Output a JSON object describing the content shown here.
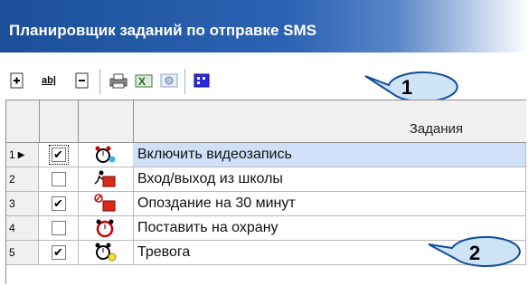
{
  "window": {
    "title": "Планировщик заданий по отправке SMS"
  },
  "toolbar": {
    "buttons": [
      {
        "icon": "add-task-icon"
      },
      {
        "icon": "rename-icon",
        "glyph": "ab|"
      },
      {
        "icon": "delete-task-icon"
      },
      {
        "icon": "print-icon"
      },
      {
        "icon": "excel-export-icon"
      },
      {
        "icon": "settings-icon"
      },
      {
        "icon": "scheduler-icon"
      }
    ]
  },
  "grid": {
    "column_header": "Задания",
    "rows": [
      {
        "num": "1",
        "checked": true,
        "check_glyph": "✔",
        "icon": "alarm-clock-key-icon",
        "label": "Включить видеозапись"
      },
      {
        "num": "2",
        "checked": false,
        "check_glyph": "",
        "icon": "person-running-icon",
        "label": "Вход/выход из школы"
      },
      {
        "num": "3",
        "checked": true,
        "check_glyph": "✔",
        "icon": "late-alarm-icon",
        "label": "Опоздание на 30 минут"
      },
      {
        "num": "4",
        "checked": false,
        "check_glyph": "",
        "icon": "alarm-clock-icon",
        "label": "Поставить на охрану"
      },
      {
        "num": "5",
        "checked": true,
        "check_glyph": "✔",
        "icon": "alarm-clock-bulb-icon",
        "label": "Тревога"
      }
    ]
  },
  "callouts": [
    {
      "label": "1"
    },
    {
      "label": "2"
    }
  ],
  "colors": {
    "title_bg": "#1b4f99",
    "selected_row": "#cfe0f8",
    "callout_fill": "#cfe3f7"
  }
}
